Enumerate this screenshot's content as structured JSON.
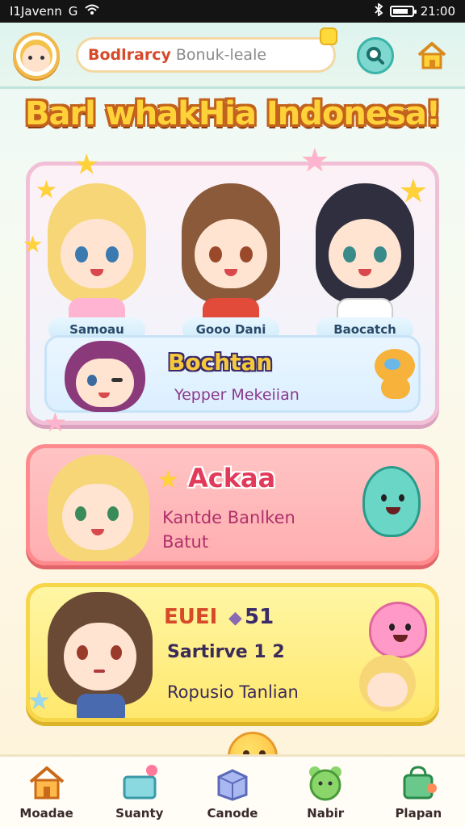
{
  "status_bar": {
    "carrier": "I1Javenn",
    "network": "G",
    "time": "21:00"
  },
  "header": {
    "search_main": "Bodlrarcy",
    "search_sub": "Bonuk-leale"
  },
  "banner": {
    "title": "Barl whakHia Indonesa!"
  },
  "characters": [
    {
      "name": "Samoau",
      "hair": "#f6d677",
      "eye": "#3a7ab0",
      "shirt": "#ffb4d2"
    },
    {
      "name": "Gooo Dani",
      "hair": "#8a5a3a",
      "eye": "#9a4a2a",
      "shirt": "#e24a3a"
    },
    {
      "name": "Baocatch",
      "hair": "#2f2f3f",
      "eye": "#3a8a8a",
      "shirt": "#ffffff"
    }
  ],
  "featured": {
    "title": "Bochtan",
    "subtitle": "Yepper Mekeiian"
  },
  "rows": [
    {
      "title": "Ackaa",
      "line1": "Kantde Banlken",
      "line2": "Batut"
    },
    {
      "title": "EUEI",
      "badge": "51",
      "line1": "Sartirve 1 2",
      "line2": "Ropusio Tanlian"
    }
  ],
  "nav": [
    {
      "label": "Moadae",
      "icon": "house-icon"
    },
    {
      "label": "Suanty",
      "icon": "gift-icon"
    },
    {
      "label": "Canode",
      "icon": "box-icon"
    },
    {
      "label": "Nabir",
      "icon": "bear-icon"
    },
    {
      "label": "Plapan",
      "icon": "bag-icon"
    }
  ],
  "colors": {
    "accent": "#ffd23a",
    "pink_panel": "#ffaeb0",
    "yellow_panel": "#ffe86e"
  }
}
